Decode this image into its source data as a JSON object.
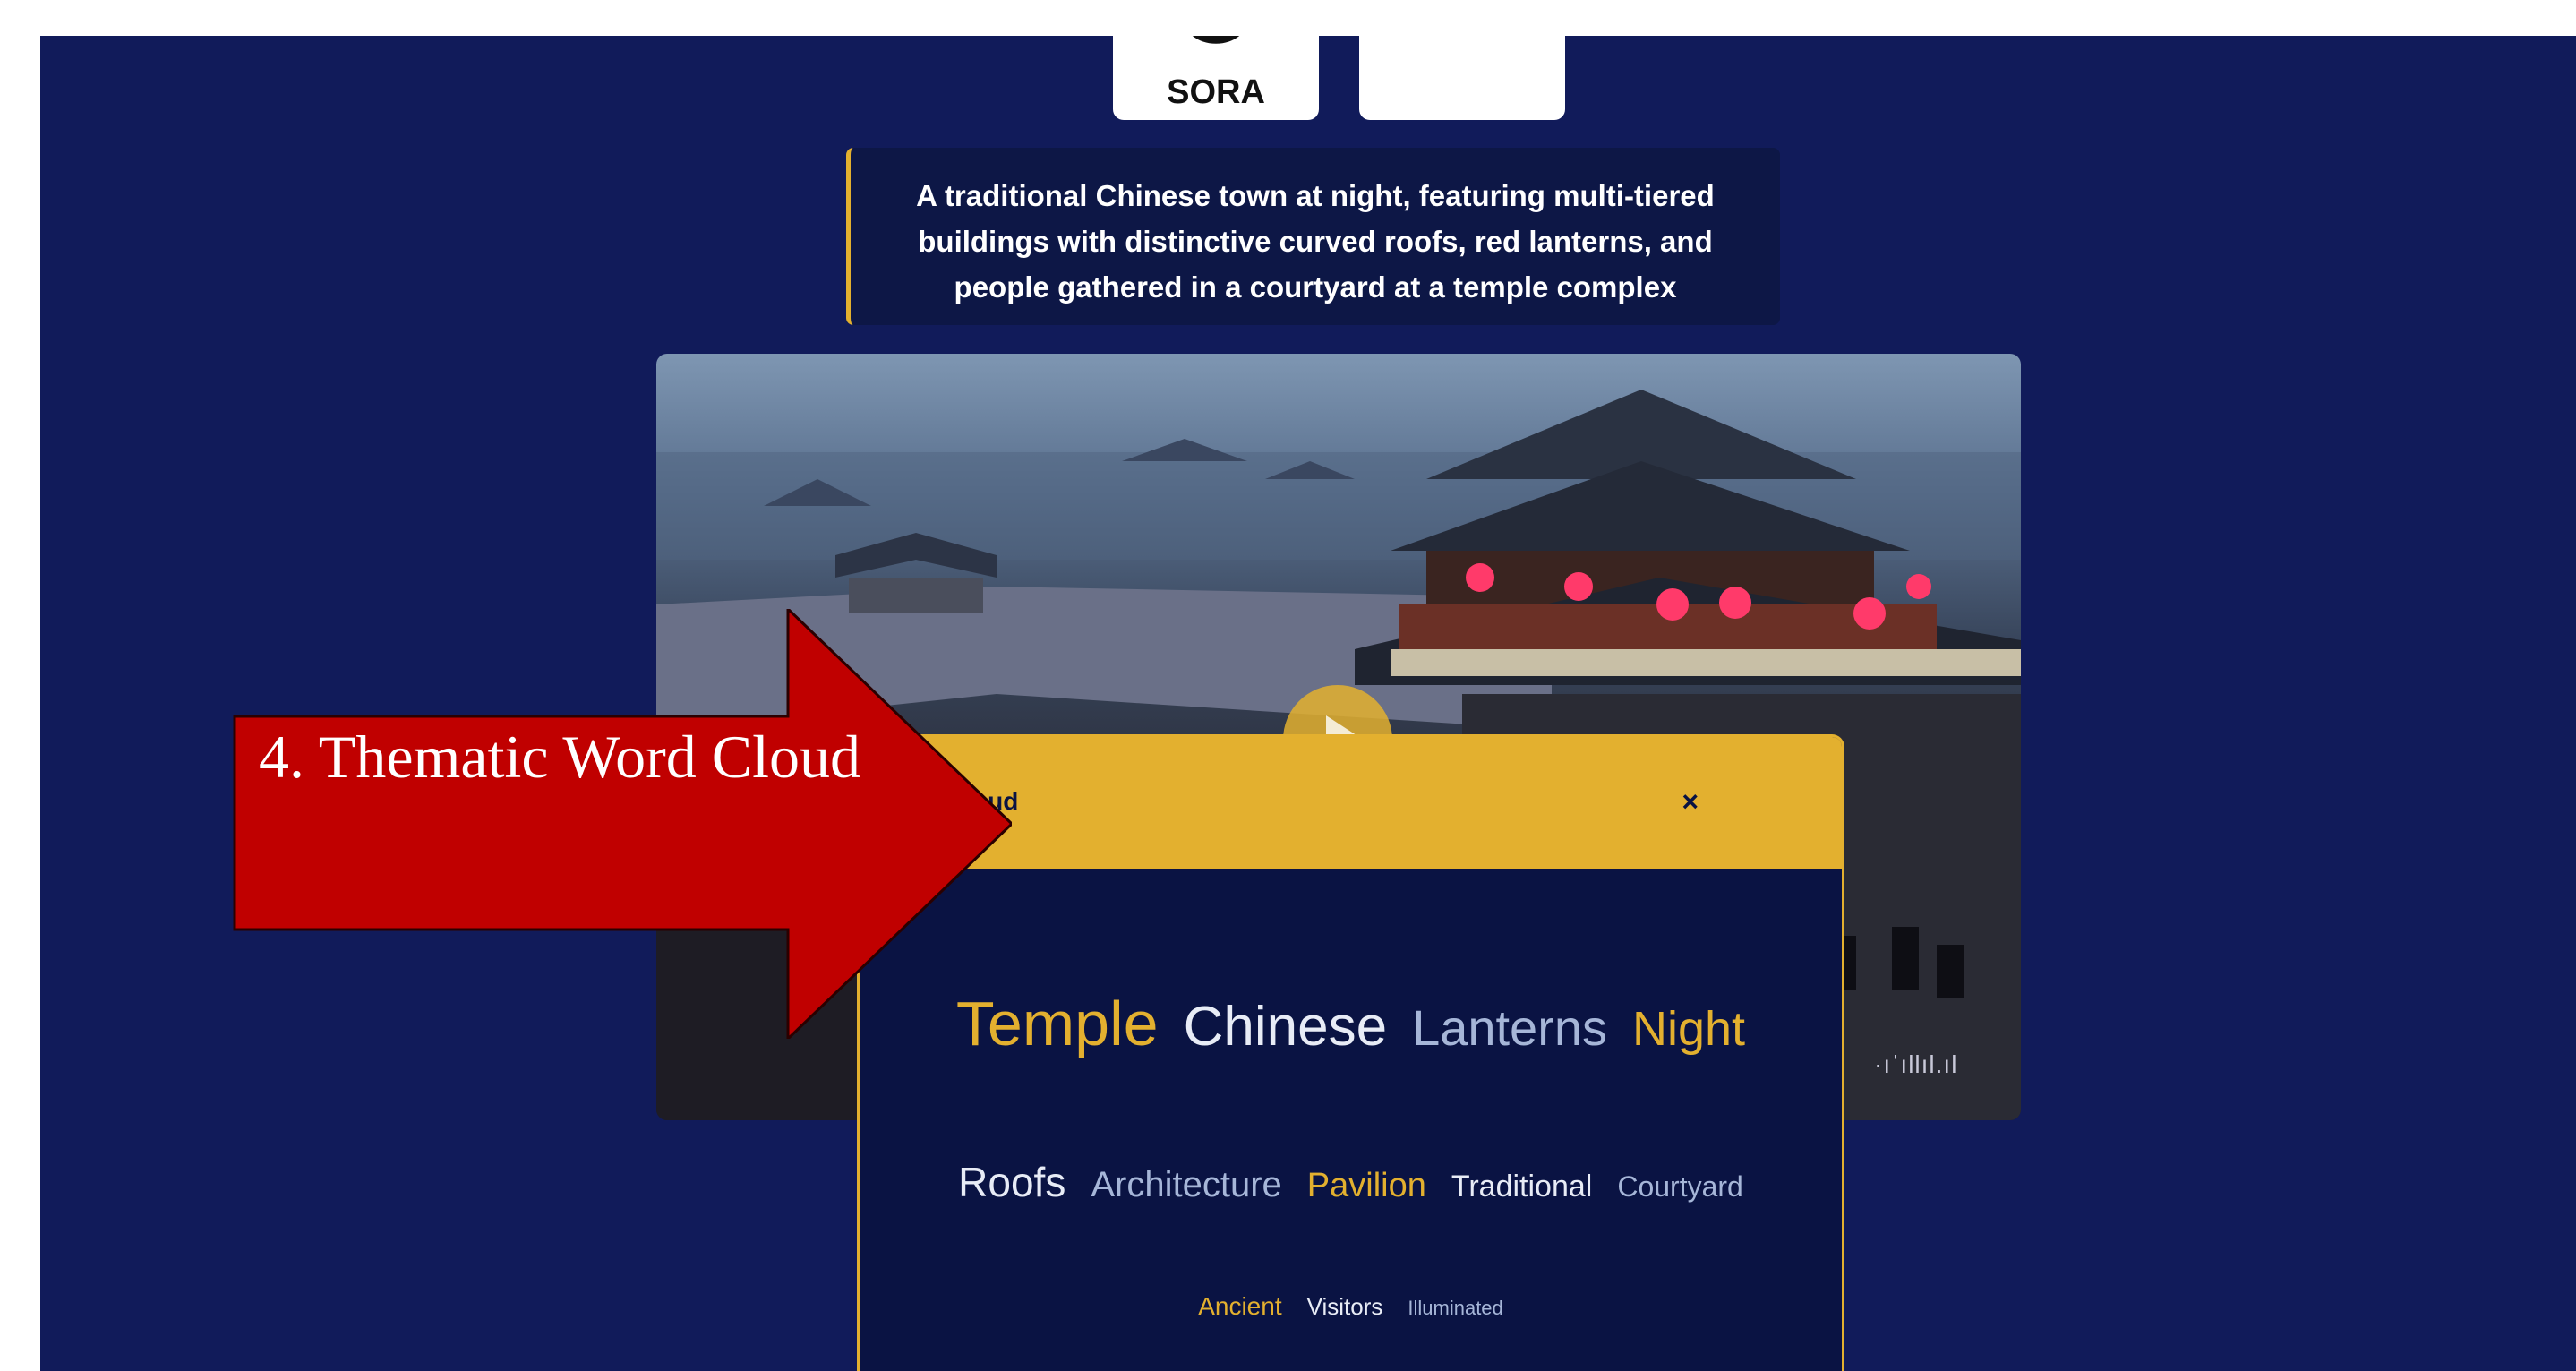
{
  "logos": {
    "sora_text": "SORA",
    "sora_icon": "openai-knot-icon",
    "other_icon": "partner-logo-icon"
  },
  "caption": {
    "text": "A traditional Chinese town at night, featuring multi-tiered buildings with distinctive curved roofs, red lanterns, and people gathered in a courtyard at a temple complex"
  },
  "video": {
    "play_icon": "play-icon",
    "audio_indicator": "·ıˈıllıl.ıl"
  },
  "modal": {
    "title_visible": "Cloud",
    "close_label": "×",
    "words": [
      [
        {
          "text": "Temple",
          "size": 70,
          "color": "#e3b02f"
        },
        {
          "text": "Chinese",
          "size": 62,
          "color": "#e8ecf6"
        },
        {
          "text": "Lanterns",
          "size": 56,
          "color": "#a6b6d8"
        },
        {
          "text": "Night",
          "size": 54,
          "color": "#e3b02f"
        }
      ],
      [
        {
          "text": "Roofs",
          "size": 46,
          "color": "#e8ecf6"
        },
        {
          "text": "Architecture",
          "size": 40,
          "color": "#a6b6d8"
        },
        {
          "text": "Pavilion",
          "size": 38,
          "color": "#e3b02f"
        },
        {
          "text": "Traditional",
          "size": 34,
          "color": "#e8ecf6"
        },
        {
          "text": "Courtyard",
          "size": 32,
          "color": "#a6b6d8"
        }
      ],
      [
        {
          "text": "Ancient",
          "size": 28,
          "color": "#e3b02f"
        },
        {
          "text": "Visitors",
          "size": 26,
          "color": "#e8ecf6"
        },
        {
          "text": "Illuminated",
          "size": 22,
          "color": "#a6b6d8"
        }
      ]
    ]
  },
  "callout": {
    "label": "4. Thematic Word Cloud",
    "color": "#c00000"
  },
  "colors": {
    "background": "#111b5a",
    "accent": "#e3b02f",
    "panel": "#0a1343"
  }
}
